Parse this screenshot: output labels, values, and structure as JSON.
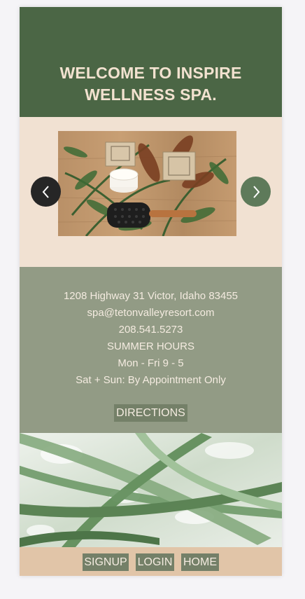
{
  "hero": {
    "title_line1": "WELCOME TO INSPIRE",
    "title_line2": "WELLNESS SPA."
  },
  "carousel": {
    "prev_icon": "chevron-left-icon",
    "next_icon": "chevron-right-icon",
    "slide_description_icon": "spa-products-photo"
  },
  "info": {
    "address": "1208 Highway 31 Victor, Idaho 83455",
    "email": "spa@tetonvalleyresort.com",
    "phone": "208.541.5273",
    "hours_title": "SUMMER HOURS",
    "weekday_hours": "Mon - Fri 9 - 5",
    "weekend_hours": "Sat + Sun: By Appointment Only",
    "directions_label": "DIRECTIONS"
  },
  "footer": {
    "signup_label": "SIGNUP",
    "login_label": "LOGIN",
    "home_label": "HOME"
  },
  "colors": {
    "hero_bg": "#4b6645",
    "carousel_bg": "#f1e1d2",
    "info_bg": "#929b85",
    "button_bg": "#748068",
    "footer_bg": "#e1c5a8",
    "text_light": "#f4ebe0"
  }
}
